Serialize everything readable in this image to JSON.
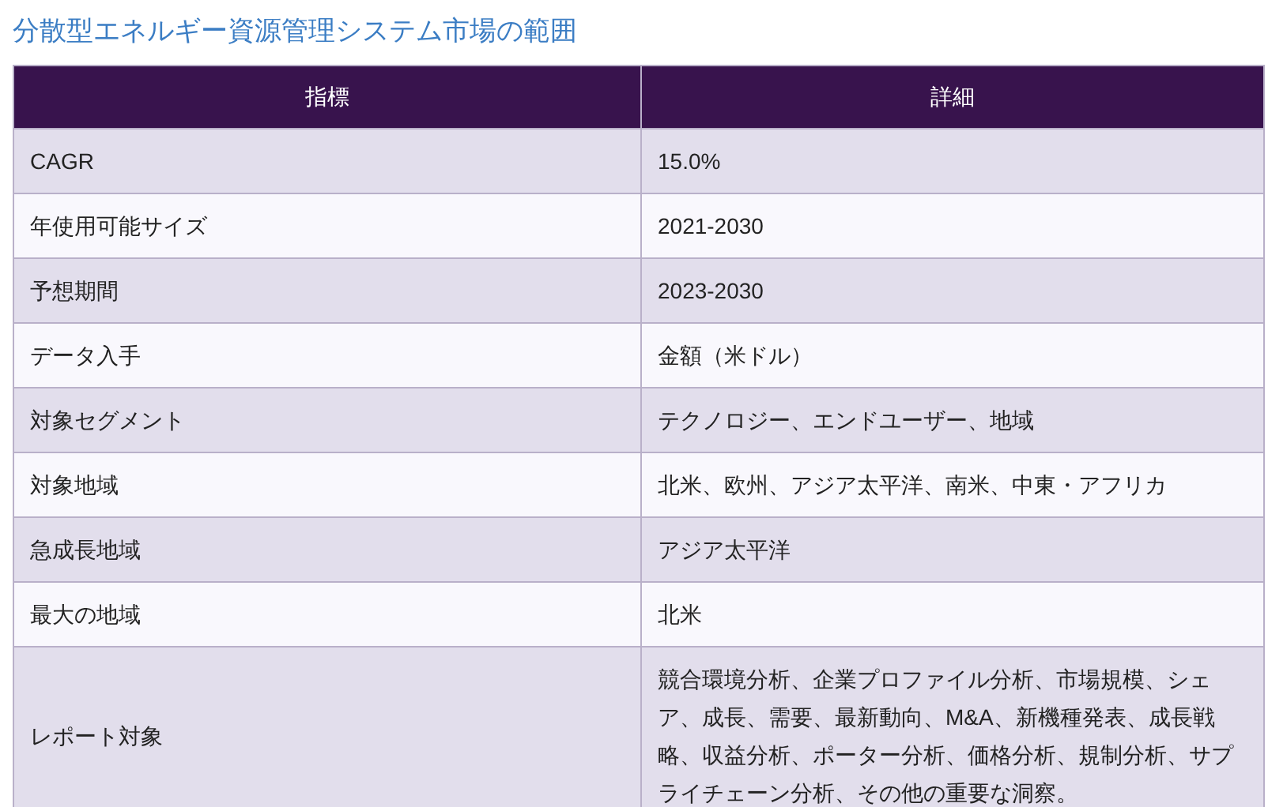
{
  "title": "分散型エネルギー資源管理システム市場の範囲",
  "table": {
    "columns": [
      "指標",
      "詳細"
    ],
    "rows": [
      [
        "CAGR",
        "15.0%"
      ],
      [
        "年使用可能サイズ",
        "2021-2030"
      ],
      [
        "予想期間",
        "2023-2030"
      ],
      [
        "データ入手",
        "金額（米ドル）"
      ],
      [
        "対象セグメント",
        "テクノロジー、エンドユーザー、地域"
      ],
      [
        "対象地域",
        "北米、欧州、アジア太平洋、南米、中東・アフリカ"
      ],
      [
        "急成長地域",
        "アジア太平洋"
      ],
      [
        "最大の地域",
        "北米"
      ],
      [
        "レポート対象",
        "競合環境分析、企業プロファイル分析、市場規模、シェア、成長、需要、最新動向、M&A、新機種発表、成長戦略、収益分析、ポーター分析、価格分析、規制分析、サプライチェーン分析、その他の重要な洞察。"
      ]
    ]
  }
}
